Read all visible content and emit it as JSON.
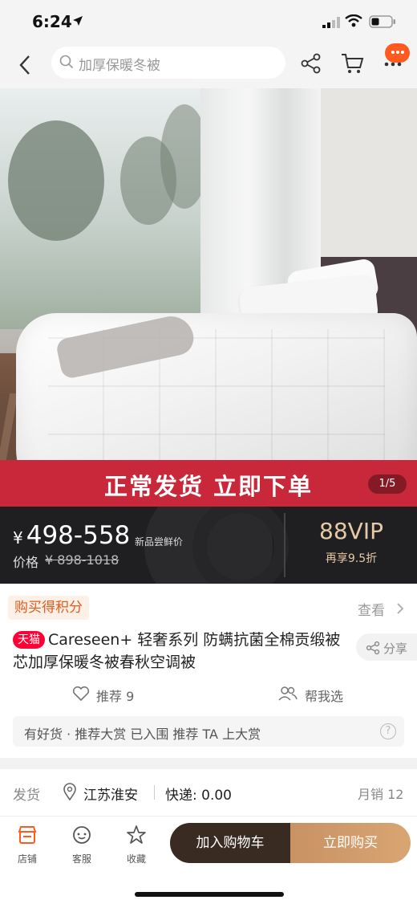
{
  "status_bar": {
    "time": "6:24"
  },
  "nav": {
    "search_placeholder": "加厚保暖冬被"
  },
  "hero": {
    "banner_text": "正常发货  立即下单",
    "page_indicator": "1/5"
  },
  "price": {
    "currency": "¥",
    "range": "498-558",
    "tag": "新品尝鲜价",
    "orig_label": "价格",
    "orig_value": "¥ 898-1018",
    "vip_title": "88VIP",
    "vip_sub": "再享9.5折"
  },
  "points": {
    "badge": "购买得积分",
    "view": "查看"
  },
  "product": {
    "store_badge": "天猫",
    "title": "Careseen+ 轻奢系列 防螨抗菌全棉贡缎被芯加厚保暖冬被春秋空调被",
    "share_label": "分享"
  },
  "recommend": {
    "recommend_label": "推荐 9",
    "help_label": "帮我选"
  },
  "good_goods": {
    "text": "有好货 · 推荐大赏 已入围 推荐 TA 上大赏",
    "help": "?"
  },
  "shipping": {
    "label": "发货",
    "location": "江苏淮安",
    "fee": "快递: 0.00",
    "monthly_sales": "月销 12"
  },
  "bottom_bar": {
    "tabs": [
      {
        "label": "店铺",
        "icon": "store-icon"
      },
      {
        "label": "客服",
        "icon": "customer-service-icon"
      },
      {
        "label": "收藏",
        "icon": "star-icon"
      }
    ],
    "add_to_cart": "加入购物车",
    "buy_now": "立即购买"
  },
  "colors": {
    "accent_orange": "#ff5a1f",
    "banner_red": "#c9283a",
    "tmall_red": "#ff0036",
    "vip_gold": "#e6c9a5",
    "cart_button": "#3a2b22",
    "buy_button": "#d9a572"
  }
}
